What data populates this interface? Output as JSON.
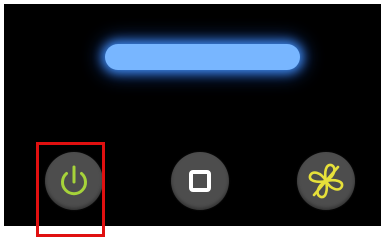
{
  "device": {
    "indicator": {
      "state": "on",
      "color": "#78b6ff"
    },
    "controls": [
      {
        "id": "power",
        "icon": "power-icon",
        "icon_color": "#a6d33a"
      },
      {
        "id": "stop",
        "icon": "stop-square-icon",
        "icon_color": "#ffffff"
      },
      {
        "id": "fan",
        "icon": "fan-off-icon",
        "icon_color": "#e6e03a"
      }
    ]
  },
  "highlight": {
    "color": "#e01010",
    "target": "power"
  }
}
